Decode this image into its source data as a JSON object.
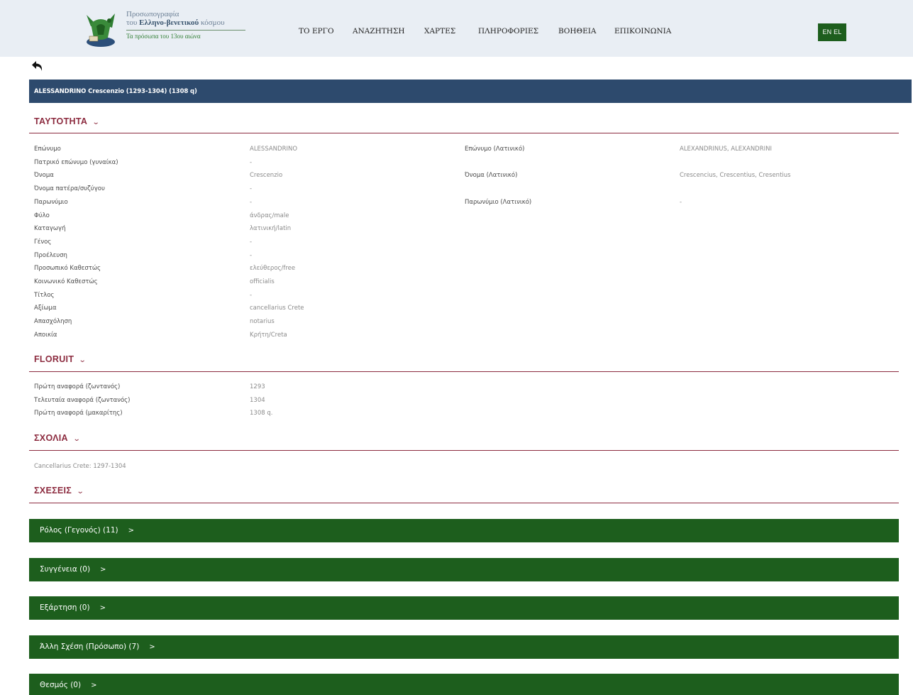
{
  "header": {
    "logo_line1": "Προσωπογραφία",
    "logo_line2_plain": "του ",
    "logo_line2_bold": "Ελληνο-βενετικού",
    "logo_line2_tail": " κόσμου",
    "logo_line3": "Τα πρόσωπα του 13ου αιώνα",
    "nav": [
      "ΤΟ ΕΡΓΟ",
      "ΑΝΑΖΗΤΗΣΗ",
      "ΧΑΡΤΕΣ",
      "ΠΛΗΡΟΦΟΡΙΕΣ",
      "ΒΟΗΘΕΙΑ",
      "ΕΠΙΚΟΙΝΩΝΙΑ"
    ],
    "lang": "EN EL"
  },
  "title": "ALESSANDRINO Crescenzio (1293-1304) (1308 q)",
  "sections": {
    "identity": "ΤΑΥΤΟΤΗΤΑ",
    "floruit": "FLORUIT",
    "notes": "ΣΧΟΛΙΑ",
    "relations": "ΣΧΕΣΕΙΣ"
  },
  "identity_left": [
    {
      "label": "Επώνυμο",
      "value": "ALESSANDRINO"
    },
    {
      "label": "Πατρικό επώνυμο (γυναίκα)",
      "value": "-"
    },
    {
      "label": "Όνομα",
      "value": "Crescenzio"
    },
    {
      "label": "Όνομα πατέρα/συζύγου",
      "value": "-"
    },
    {
      "label": "Παρωνύμιο",
      "value": "-"
    },
    {
      "label": "Φύλο",
      "value": "άνδρας/male"
    },
    {
      "label": "Καταγωγή",
      "value": "λατινική/latin"
    },
    {
      "label": "Γένος",
      "value": "-"
    },
    {
      "label": "Προέλευση",
      "value": "-"
    },
    {
      "label": "Προσωπικό Καθεστώς",
      "value": "ελεύθερος/free"
    },
    {
      "label": "Κοινωνικό Καθεστώς",
      "value": "officialis"
    },
    {
      "label": "Τίτλος",
      "value": "-"
    },
    {
      "label": "Αξίωμα",
      "value": "cancellarius Crete"
    },
    {
      "label": "Απασχόληση",
      "value": "notarius"
    },
    {
      "label": "Αποικία",
      "value": "Κρήτη/Creta"
    }
  ],
  "identity_right": [
    {
      "label": "Επώνυμο (Λατινικό)",
      "value": "ALEXANDRINUS, ALEXANDRINI"
    },
    {
      "label": "Όνομα (Λατινικό)",
      "value": "Crescencius, Crescentius, Cresentius"
    },
    {
      "label": "Παρωνύμιο (Λατινικό)",
      "value": "-"
    }
  ],
  "floruit": [
    {
      "label": "Πρώτη αναφορά (ζωντανός)",
      "value": "1293"
    },
    {
      "label": "Τελευταία αναφορά (ζωντανός)",
      "value": "1304"
    },
    {
      "label": "Πρώτη αναφορά (μακαρίτης)",
      "value": "1308 q."
    }
  ],
  "notes_text": "Cancellarius Crete: 1297-1304",
  "relations": [
    "Ρόλος (Γεγονός) (11)",
    "Συγγένεια (0)",
    "Εξάρτηση (0)",
    "Άλλη Σχέση (Πρόσωπο) (7)",
    "Θεσμός (0)"
  ],
  "icons": {
    "back": "back-arrow-icon",
    "section_toggle": "chevron-down-icon",
    "relation_toggle": "chevron-right-icon"
  },
  "colors": {
    "header_bg": "#e9eef4",
    "title_bar": "#2d4a6d",
    "section": "#8c2b3f",
    "relation_bar": "#1d5e1d"
  }
}
